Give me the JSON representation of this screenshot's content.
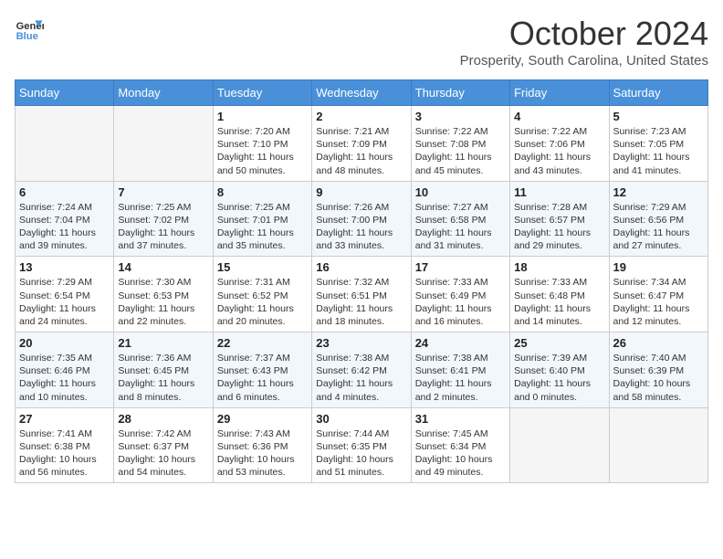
{
  "header": {
    "logo_line1": "General",
    "logo_line2": "Blue",
    "month_title": "October 2024",
    "location": "Prosperity, South Carolina, United States"
  },
  "days_of_week": [
    "Sunday",
    "Monday",
    "Tuesday",
    "Wednesday",
    "Thursday",
    "Friday",
    "Saturday"
  ],
  "weeks": [
    [
      {
        "day": "",
        "sunrise": "",
        "sunset": "",
        "daylight": ""
      },
      {
        "day": "",
        "sunrise": "",
        "sunset": "",
        "daylight": ""
      },
      {
        "day": "1",
        "sunrise": "Sunrise: 7:20 AM",
        "sunset": "Sunset: 7:10 PM",
        "daylight": "Daylight: 11 hours and 50 minutes."
      },
      {
        "day": "2",
        "sunrise": "Sunrise: 7:21 AM",
        "sunset": "Sunset: 7:09 PM",
        "daylight": "Daylight: 11 hours and 48 minutes."
      },
      {
        "day": "3",
        "sunrise": "Sunrise: 7:22 AM",
        "sunset": "Sunset: 7:08 PM",
        "daylight": "Daylight: 11 hours and 45 minutes."
      },
      {
        "day": "4",
        "sunrise": "Sunrise: 7:22 AM",
        "sunset": "Sunset: 7:06 PM",
        "daylight": "Daylight: 11 hours and 43 minutes."
      },
      {
        "day": "5",
        "sunrise": "Sunrise: 7:23 AM",
        "sunset": "Sunset: 7:05 PM",
        "daylight": "Daylight: 11 hours and 41 minutes."
      }
    ],
    [
      {
        "day": "6",
        "sunrise": "Sunrise: 7:24 AM",
        "sunset": "Sunset: 7:04 PM",
        "daylight": "Daylight: 11 hours and 39 minutes."
      },
      {
        "day": "7",
        "sunrise": "Sunrise: 7:25 AM",
        "sunset": "Sunset: 7:02 PM",
        "daylight": "Daylight: 11 hours and 37 minutes."
      },
      {
        "day": "8",
        "sunrise": "Sunrise: 7:25 AM",
        "sunset": "Sunset: 7:01 PM",
        "daylight": "Daylight: 11 hours and 35 minutes."
      },
      {
        "day": "9",
        "sunrise": "Sunrise: 7:26 AM",
        "sunset": "Sunset: 7:00 PM",
        "daylight": "Daylight: 11 hours and 33 minutes."
      },
      {
        "day": "10",
        "sunrise": "Sunrise: 7:27 AM",
        "sunset": "Sunset: 6:58 PM",
        "daylight": "Daylight: 11 hours and 31 minutes."
      },
      {
        "day": "11",
        "sunrise": "Sunrise: 7:28 AM",
        "sunset": "Sunset: 6:57 PM",
        "daylight": "Daylight: 11 hours and 29 minutes."
      },
      {
        "day": "12",
        "sunrise": "Sunrise: 7:29 AM",
        "sunset": "Sunset: 6:56 PM",
        "daylight": "Daylight: 11 hours and 27 minutes."
      }
    ],
    [
      {
        "day": "13",
        "sunrise": "Sunrise: 7:29 AM",
        "sunset": "Sunset: 6:54 PM",
        "daylight": "Daylight: 11 hours and 24 minutes."
      },
      {
        "day": "14",
        "sunrise": "Sunrise: 7:30 AM",
        "sunset": "Sunset: 6:53 PM",
        "daylight": "Daylight: 11 hours and 22 minutes."
      },
      {
        "day": "15",
        "sunrise": "Sunrise: 7:31 AM",
        "sunset": "Sunset: 6:52 PM",
        "daylight": "Daylight: 11 hours and 20 minutes."
      },
      {
        "day": "16",
        "sunrise": "Sunrise: 7:32 AM",
        "sunset": "Sunset: 6:51 PM",
        "daylight": "Daylight: 11 hours and 18 minutes."
      },
      {
        "day": "17",
        "sunrise": "Sunrise: 7:33 AM",
        "sunset": "Sunset: 6:49 PM",
        "daylight": "Daylight: 11 hours and 16 minutes."
      },
      {
        "day": "18",
        "sunrise": "Sunrise: 7:33 AM",
        "sunset": "Sunset: 6:48 PM",
        "daylight": "Daylight: 11 hours and 14 minutes."
      },
      {
        "day": "19",
        "sunrise": "Sunrise: 7:34 AM",
        "sunset": "Sunset: 6:47 PM",
        "daylight": "Daylight: 11 hours and 12 minutes."
      }
    ],
    [
      {
        "day": "20",
        "sunrise": "Sunrise: 7:35 AM",
        "sunset": "Sunset: 6:46 PM",
        "daylight": "Daylight: 11 hours and 10 minutes."
      },
      {
        "day": "21",
        "sunrise": "Sunrise: 7:36 AM",
        "sunset": "Sunset: 6:45 PM",
        "daylight": "Daylight: 11 hours and 8 minutes."
      },
      {
        "day": "22",
        "sunrise": "Sunrise: 7:37 AM",
        "sunset": "Sunset: 6:43 PM",
        "daylight": "Daylight: 11 hours and 6 minutes."
      },
      {
        "day": "23",
        "sunrise": "Sunrise: 7:38 AM",
        "sunset": "Sunset: 6:42 PM",
        "daylight": "Daylight: 11 hours and 4 minutes."
      },
      {
        "day": "24",
        "sunrise": "Sunrise: 7:38 AM",
        "sunset": "Sunset: 6:41 PM",
        "daylight": "Daylight: 11 hours and 2 minutes."
      },
      {
        "day": "25",
        "sunrise": "Sunrise: 7:39 AM",
        "sunset": "Sunset: 6:40 PM",
        "daylight": "Daylight: 11 hours and 0 minutes."
      },
      {
        "day": "26",
        "sunrise": "Sunrise: 7:40 AM",
        "sunset": "Sunset: 6:39 PM",
        "daylight": "Daylight: 10 hours and 58 minutes."
      }
    ],
    [
      {
        "day": "27",
        "sunrise": "Sunrise: 7:41 AM",
        "sunset": "Sunset: 6:38 PM",
        "daylight": "Daylight: 10 hours and 56 minutes."
      },
      {
        "day": "28",
        "sunrise": "Sunrise: 7:42 AM",
        "sunset": "Sunset: 6:37 PM",
        "daylight": "Daylight: 10 hours and 54 minutes."
      },
      {
        "day": "29",
        "sunrise": "Sunrise: 7:43 AM",
        "sunset": "Sunset: 6:36 PM",
        "daylight": "Daylight: 10 hours and 53 minutes."
      },
      {
        "day": "30",
        "sunrise": "Sunrise: 7:44 AM",
        "sunset": "Sunset: 6:35 PM",
        "daylight": "Daylight: 10 hours and 51 minutes."
      },
      {
        "day": "31",
        "sunrise": "Sunrise: 7:45 AM",
        "sunset": "Sunset: 6:34 PM",
        "daylight": "Daylight: 10 hours and 49 minutes."
      },
      {
        "day": "",
        "sunrise": "",
        "sunset": "",
        "daylight": ""
      },
      {
        "day": "",
        "sunrise": "",
        "sunset": "",
        "daylight": ""
      }
    ]
  ]
}
